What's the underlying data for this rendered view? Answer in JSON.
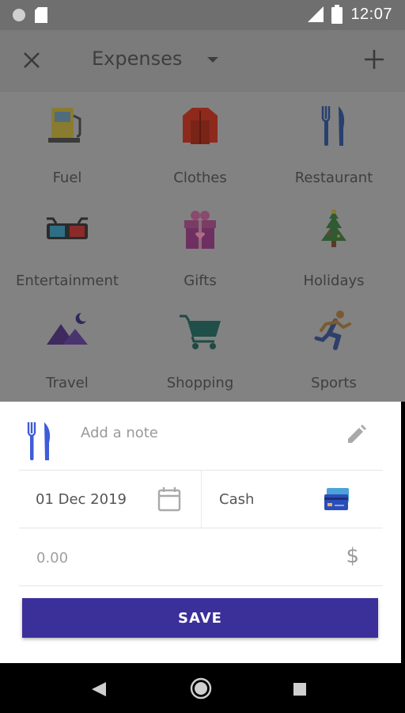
{
  "status_bar": {
    "time": "12:07",
    "network": "LTE"
  },
  "toolbar": {
    "title": "Expenses"
  },
  "categories": [
    {
      "label": "Fuel",
      "icon": "fuel-pump-icon"
    },
    {
      "label": "Clothes",
      "icon": "jacket-icon"
    },
    {
      "label": "Restaurant",
      "icon": "fork-knife-icon"
    },
    {
      "label": "Entertainment",
      "icon": "3d-glasses-icon"
    },
    {
      "label": "Gifts",
      "icon": "gift-box-icon"
    },
    {
      "label": "Holidays",
      "icon": "christmas-tree-icon"
    },
    {
      "label": "Travel",
      "icon": "mountains-icon"
    },
    {
      "label": "Shopping",
      "icon": "shopping-cart-icon"
    },
    {
      "label": "Sports",
      "icon": "runner-icon"
    }
  ],
  "form": {
    "note_placeholder": "Add a note",
    "note_value": "",
    "date": "01 Dec 2019",
    "payment": "Cash",
    "amount_placeholder": "0.00",
    "amount_value": "",
    "currency": "$",
    "save_label": "SAVE"
  },
  "colors": {
    "accent": "#3b2f9a",
    "scrim": "#7f7f7f"
  }
}
